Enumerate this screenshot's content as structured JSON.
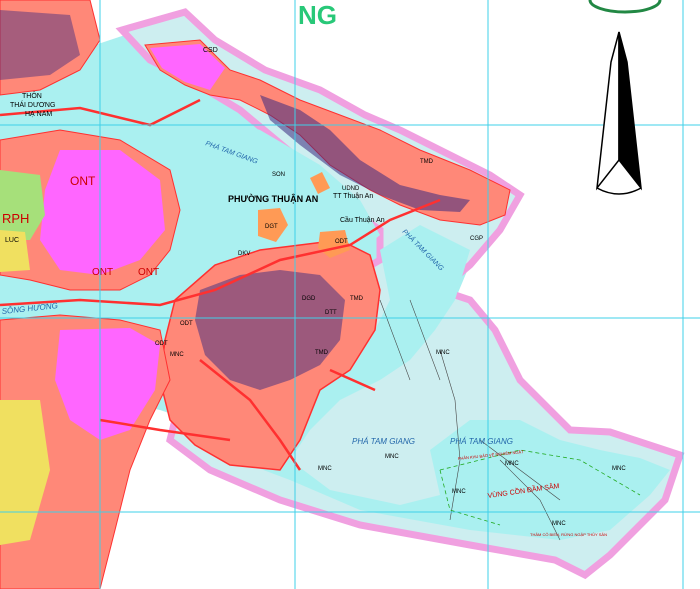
{
  "colors": {
    "water": "#aaf0f0",
    "district_boundary": "#f0a0e0",
    "residential": "#ff8878",
    "commercial": "#ff66ff",
    "land_fill": "#ffbbdd",
    "open_land": "#cdeef0",
    "grid": "#3fd0e8",
    "road": "#ff3030",
    "urban_block": "#3a2a80",
    "agri_yellow": "#f0e060",
    "agri_green": "#a6e07a",
    "facility_orange": "#ff9a55"
  },
  "labels": {
    "top_partial": "NG",
    "ward_name": "PHƯỜNG THUẬN AN",
    "son": "SON",
    "tt_thuan_an": "TT Thuận An",
    "udnd": "UDND",
    "cau_thuan_an": "Cầu Thuận An",
    "thon_1": "THÔN",
    "thon_2": "THÁI DƯƠNG",
    "thon_3": "HẠ NAM",
    "csd": "CSD",
    "ont_1": "ONT",
    "ont_2": "ONT",
    "ont_3": "ONT",
    "rph": "RPH",
    "luc": "LUC",
    "song_huong": "SÔNG HƯƠNG",
    "tam_giang_1": "PHÁ TAM GIANG",
    "tam_giang_2": "PHÁ TAM GIANG",
    "tam_giang_3": "PHÁ TAM GIANG",
    "tam_giang_4": "PHÁ TAM GIANG",
    "mnc_1": "MNC",
    "mnc_2": "MNC",
    "mnc_3": "MNC",
    "mnc_4": "MNC",
    "mnc_5": "MNC",
    "mnc_6": "MNC",
    "mnc_7": "MNC",
    "mnc_8": "MNC",
    "odt_1": "ODT",
    "odt_2": "ODT",
    "odt_3": "ODT",
    "tmd_1": "TMD",
    "tmd_2": "TMD",
    "dkv": "DKV",
    "dgd": "DGD",
    "dtt": "DTT",
    "dgt": "DGT",
    "tmd_3": "TMD",
    "con_dam_sam": "VÙNG CỒN ĐẦM SÂM",
    "bao_ve": "PHÂN KHU BẢO VỆ NGHIÊM NGẶT",
    "thuy_san": "THẢM CỎ BIỂN, RỪNG NGẬP THỦY SẢN",
    "cgp": "CGP"
  },
  "icons": {
    "north_arrow": "north-arrow-icon"
  }
}
